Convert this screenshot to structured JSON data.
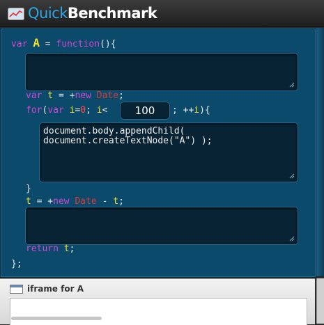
{
  "app": {
    "title_light": "Quick",
    "title_bold": "Benchmark",
    "icon": "chart-icon"
  },
  "editor": {
    "line1": {
      "var_kw": "var",
      "name": "A",
      "eq": " = ",
      "fn_kw": "function",
      "rest": "(){"
    },
    "setup_code": "",
    "line_t": {
      "var_kw": "var",
      "t": "t",
      "eq": " = +",
      "new_kw": "new",
      "date": "Date",
      "semi": ";"
    },
    "line_for": {
      "for_kw": "for",
      "open": "(",
      "var_kw": "var",
      "i": "i",
      "eq": "=",
      "zero": "0",
      "semi": "; ",
      "i2": "i",
      "lt": "<",
      "rest": "; ++",
      "i3": "i",
      "close": "){"
    },
    "iterations": "100",
    "loop_code": "document.body.appendChild(\ndocument.createTextNode(\"A\") );",
    "close_brace": "}",
    "line_t2": {
      "t": "t",
      "eq": " = +",
      "new_kw": "new",
      "date": "Date",
      "minus": " - ",
      "t2": "t",
      "semi": ";"
    },
    "teardown_code": "",
    "line_return": {
      "ret_kw": "return",
      "t": "t",
      "semi": ";"
    },
    "end": "};"
  },
  "iframe_panel": {
    "title": "iframe for A",
    "icon": "window-icon"
  }
}
